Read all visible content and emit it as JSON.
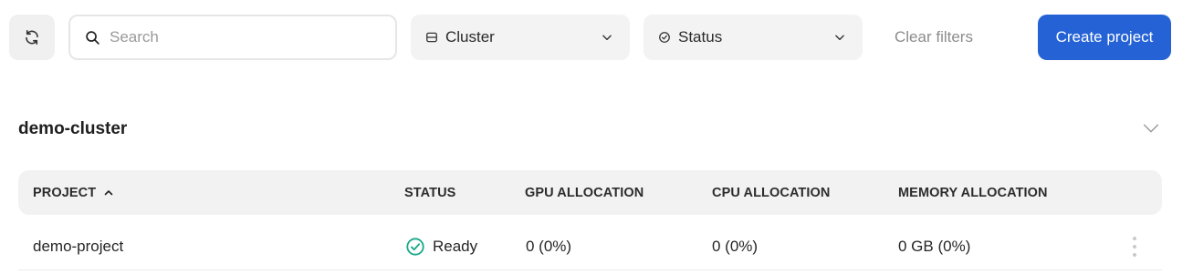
{
  "toolbar": {
    "search_placeholder": "Search",
    "cluster_filter_label": "Cluster",
    "status_filter_label": "Status",
    "clear_filters_label": "Clear filters",
    "create_project_label": "Create project"
  },
  "cluster": {
    "name": "demo-cluster",
    "table": {
      "columns": [
        "PROJECT",
        "STATUS",
        "GPU ALLOCATION",
        "CPU ALLOCATION",
        "MEMORY ALLOCATION"
      ],
      "sort_column": "PROJECT",
      "sort_direction": "ascending",
      "rows": [
        {
          "project": "demo-project",
          "status": "Ready",
          "gpu_allocation": "0 (0%)",
          "cpu_allocation": "0 (0%)",
          "memory_allocation": "0 GB (0%)"
        }
      ]
    }
  },
  "colors": {
    "primary": "#2462d6",
    "status_ready": "#1aa88a"
  },
  "icons": [
    "refresh-icon",
    "search-icon",
    "server-icon",
    "status-icon",
    "chevron-down-icon",
    "sort-up-icon",
    "check-circle-icon",
    "kebab-menu-icon"
  ]
}
